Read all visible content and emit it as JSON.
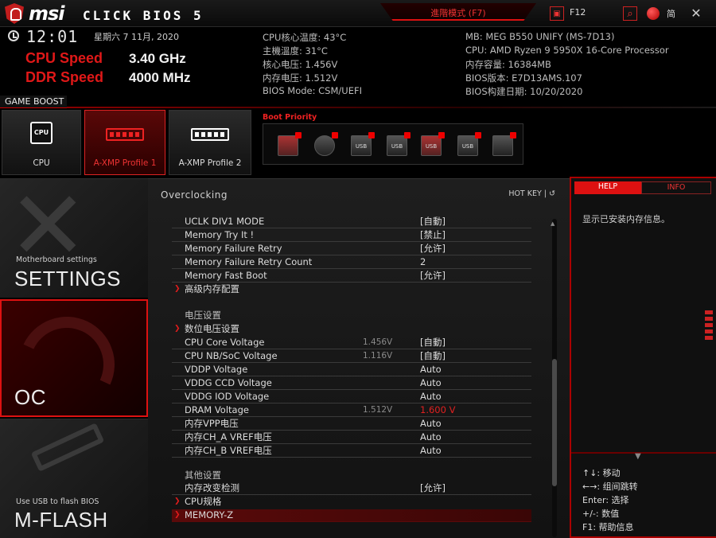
{
  "header": {
    "brand": "msi",
    "product": "CLICK BIOS 5",
    "mode_tab": "進階模式 (F7)",
    "screenshot_label": "F12",
    "language_label": "简"
  },
  "info": {
    "time": "12:01",
    "date": "星期六 7 11月, 2020",
    "cpu_speed_label": "CPU Speed",
    "cpu_speed_value": "3.40 GHz",
    "ddr_speed_label": "DDR Speed",
    "ddr_speed_value": "4000 MHz",
    "left_col": [
      "CPU核心温度: 43°C",
      "主機溫度: 31°C",
      "核心电压: 1.456V",
      "内存电压: 1.512V",
      "BIOS Mode: CSM/UEFI"
    ],
    "right_col": [
      "MB: MEG B550 UNIFY (MS-7D13)",
      "CPU: AMD Ryzen 9 5950X 16-Core Processor",
      "内存容量: 16384MB",
      "BIOS版本: E7D13AMS.107",
      "BIOS构建日期: 10/20/2020"
    ]
  },
  "game_boost": {
    "label": "GAME BOOST",
    "profiles": [
      {
        "label": "CPU",
        "icon_text": "CPU"
      },
      {
        "label": "A-XMP Profile 1"
      },
      {
        "label": "A-XMP Profile 2"
      }
    ],
    "boot_priority_title": "Boot Priority",
    "boot_devices": [
      {
        "icon": "hdd-icon",
        "text": ""
      },
      {
        "icon": "optical-disc-icon",
        "text": ""
      },
      {
        "icon": "usb-icon",
        "text": "USB"
      },
      {
        "icon": "usb-disc-icon",
        "text": "USB"
      },
      {
        "icon": "usb-floppy-icon",
        "text": "USB"
      },
      {
        "icon": "usb-drive-icon",
        "text": "USB"
      },
      {
        "icon": "network-icon",
        "text": ""
      }
    ]
  },
  "nav": {
    "settings_sub": "Motherboard settings",
    "settings": "SETTINGS",
    "oc": "OC",
    "mflash_sub": "Use USB to flash BIOS",
    "mflash": "M-FLASH"
  },
  "panel": {
    "breadcrumb": "Overclocking",
    "hotkey": "HOT KEY | ↺",
    "rows_a": [
      {
        "name": "UCLK DIV1 MODE",
        "value": "[自動]"
      },
      {
        "name": "Memory Try It !",
        "value": "[禁止]"
      },
      {
        "name": "Memory Failure Retry",
        "value": "[允许]"
      },
      {
        "name": "Memory Failure Retry Count",
        "value": "2"
      },
      {
        "name": "Memory Fast Boot",
        "value": "[允许]"
      },
      {
        "name": "高级内存配置",
        "value": ""
      }
    ],
    "voltage_section": "电压设置",
    "rows_b": [
      {
        "name": "数位电压设置",
        "cur": "",
        "value": ""
      },
      {
        "name": "CPU Core Voltage",
        "cur": "1.456V",
        "value": "[自動]"
      },
      {
        "name": "CPU NB/SoC Voltage",
        "cur": "1.116V",
        "value": "[自動]"
      },
      {
        "name": "VDDP Voltage",
        "cur": "",
        "value": "Auto"
      },
      {
        "name": "VDDG CCD Voltage",
        "cur": "",
        "value": "Auto"
      },
      {
        "name": "VDDG IOD Voltage",
        "cur": "",
        "value": "Auto"
      },
      {
        "name": "DRAM Voltage",
        "cur": "1.512V",
        "value": "1.600 V"
      },
      {
        "name": "内存VPP电压",
        "cur": "",
        "value": "Auto"
      },
      {
        "name": "内存CH_A VREF电压",
        "cur": "",
        "value": "Auto"
      },
      {
        "name": "内存CH_B VREF电压",
        "cur": "",
        "value": "Auto"
      }
    ],
    "other_section": "其他设置",
    "rows_c": [
      {
        "name": "内存改变检测",
        "value": "[允许]"
      },
      {
        "name": "CPU规格",
        "value": ""
      },
      {
        "name": "MEMORY-Z",
        "value": ""
      }
    ]
  },
  "help": {
    "tab_help": "HELP",
    "tab_info": "INFO",
    "text": "显示已安装内存信息。",
    "keys": [
      "↑↓: 移动",
      "←→: 组间跳转",
      "Enter: 选择",
      "+/-: 数值",
      "F1: 帮助信息"
    ]
  },
  "colors": {
    "accent": "#e01818",
    "panel": "#181818"
  }
}
